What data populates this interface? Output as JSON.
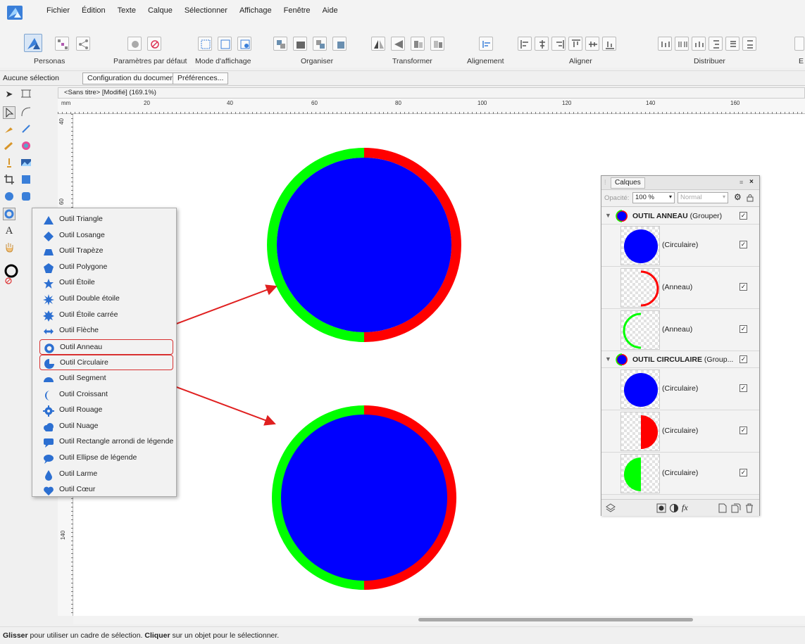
{
  "menu": [
    "Fichier",
    "Édition",
    "Texte",
    "Calque",
    "Sélectionner",
    "Affichage",
    "Fenêtre",
    "Aide"
  ],
  "toolbar": {
    "groups": [
      "Personas",
      "Paramètres par défaut",
      "Mode d'affichage",
      "Organiser",
      "Transformer",
      "Alignement",
      "Aligner",
      "Distribuer"
    ],
    "cut_label": "E"
  },
  "context": {
    "selection": "Aucune sélection",
    "doc_setup": "Configuration du document...",
    "preferences": "Préférences..."
  },
  "document": {
    "tab_title": "<Sans titre> [Modifié] (169.1%)"
  },
  "ruler": {
    "unit": "mm",
    "top": [
      "20",
      "40",
      "60",
      "80",
      "100",
      "120",
      "140",
      "160"
    ],
    "left": [
      "40",
      "60",
      "140"
    ]
  },
  "shape_menu": {
    "items": [
      {
        "label": "Outil Triangle",
        "icon": "triangle-icon"
      },
      {
        "label": "Outil Losange",
        "icon": "diamond-icon"
      },
      {
        "label": "Outil Trapèze",
        "icon": "trapezoid-icon"
      },
      {
        "label": "Outil Polygone",
        "icon": "polygon-icon"
      },
      {
        "label": "Outil Étoile",
        "icon": "star-icon"
      },
      {
        "label": "Outil Double étoile",
        "icon": "double-star-icon"
      },
      {
        "label": "Outil Étoile carrée",
        "icon": "square-star-icon"
      },
      {
        "label": "Outil Flèche",
        "icon": "arrow-icon"
      },
      {
        "label": "Outil Anneau",
        "icon": "donut-icon"
      },
      {
        "label": "Outil Circulaire",
        "icon": "pie-icon"
      },
      {
        "label": "Outil Segment",
        "icon": "segment-icon"
      },
      {
        "label": "Outil Croissant",
        "icon": "crescent-icon"
      },
      {
        "label": "Outil Rouage",
        "icon": "cog-icon"
      },
      {
        "label": "Outil Nuage",
        "icon": "cloud-icon"
      },
      {
        "label": "Outil Rectangle arrondi de légende",
        "icon": "callout-rect-icon"
      },
      {
        "label": "Outil Ellipse de légende",
        "icon": "callout-ellipse-icon"
      },
      {
        "label": "Outil Larme",
        "icon": "tear-icon"
      },
      {
        "label": "Outil Cœur",
        "icon": "heart-icon"
      }
    ],
    "highlighted": [
      "Outil Anneau",
      "Outil Circulaire"
    ]
  },
  "layers_panel": {
    "tab": "Calques",
    "opacity_label": "Opacité:",
    "opacity": "100 %",
    "blend_mode": "Normal",
    "rows": [
      {
        "kind": "group",
        "bold": "OUTIL ANNEAU",
        "rest": " (Grouper)"
      },
      {
        "kind": "child",
        "name": "(Circulaire)",
        "thumb": "full-blue"
      },
      {
        "kind": "child",
        "name": "(Anneau)",
        "thumb": "red-arc"
      },
      {
        "kind": "child",
        "name": "(Anneau)",
        "thumb": "green-arc"
      },
      {
        "kind": "group",
        "bold": "OUTIL CIRCULAIRE",
        "rest": " (Group..."
      },
      {
        "kind": "child",
        "name": "(Circulaire)",
        "thumb": "full-blue"
      },
      {
        "kind": "child",
        "name": "(Circulaire)",
        "thumb": "red-half"
      },
      {
        "kind": "child",
        "name": "(Circulaire)",
        "thumb": "green-half"
      }
    ],
    "footer_fx": "fx"
  },
  "status": {
    "b1": "Glisser",
    "t1": " pour utiliser un cadre de sélection. ",
    "b2": "Cliquer",
    "t2": " sur un objet pour le sélectionner."
  },
  "colors": {
    "blue": "#0000ff",
    "red": "#ff0000",
    "green": "#00ff00",
    "annotation": "#e02020"
  }
}
